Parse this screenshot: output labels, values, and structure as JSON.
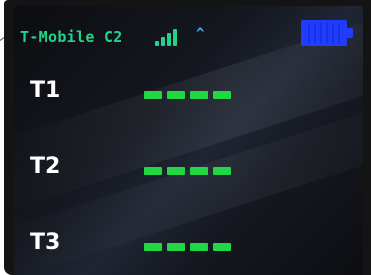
{
  "status_bar": {
    "carrier": "T-Mobile C2",
    "signal_icon": "signal-bars-icon",
    "arrow_icon": "^",
    "battery_icon": "battery-full-icon",
    "colors": {
      "carrier": "#22d38a",
      "signal": "#22d38a",
      "arrow": "#3aa6ff",
      "battery": "#1f3cff"
    }
  },
  "rows": [
    {
      "label": "T1",
      "dash_count": 4
    },
    {
      "label": "T2",
      "dash_count": 4
    },
    {
      "label": "T3",
      "dash_count": 4
    }
  ],
  "colors": {
    "dash": "#21d844",
    "label": "#ffffff",
    "background": "#141414"
  }
}
